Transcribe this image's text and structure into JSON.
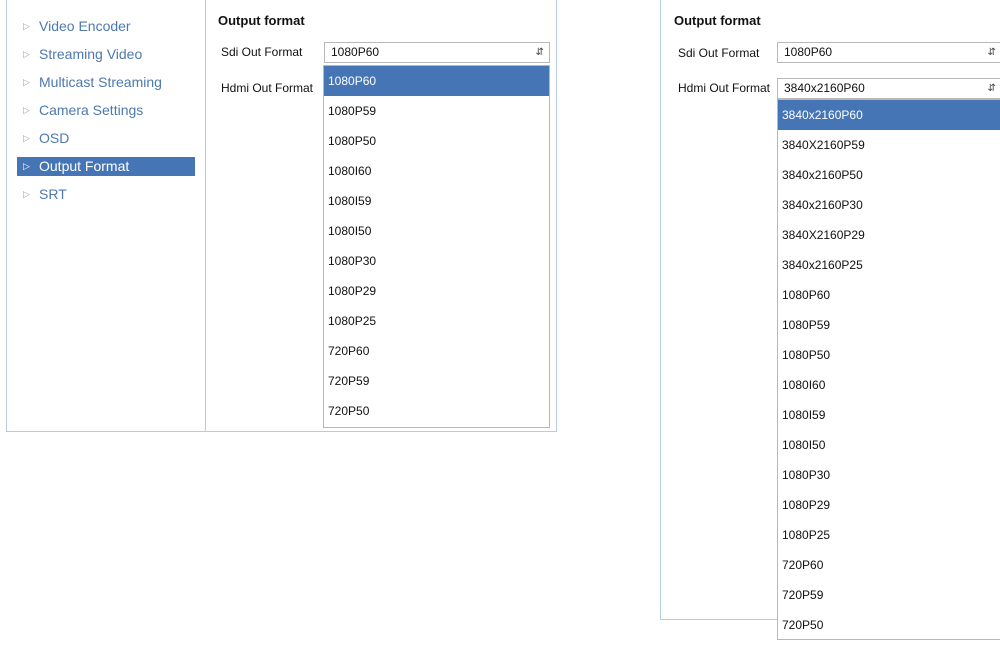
{
  "left": {
    "sidebar": {
      "items": [
        {
          "label": "Video Encoder"
        },
        {
          "label": "Streaming Video"
        },
        {
          "label": "Multicast Streaming"
        },
        {
          "label": "Camera Settings"
        },
        {
          "label": "OSD"
        },
        {
          "label": "Output Format"
        },
        {
          "label": "SRT"
        }
      ],
      "active_index": 5
    },
    "section_title": "Output format",
    "sdi_label": "Sdi Out Format",
    "sdi_value": "1080P60",
    "hdmi_label": "Hdmi Out Format",
    "dropdown_options": [
      "1080P60",
      "1080P59",
      "1080P50",
      "1080I60",
      "1080I59",
      "1080I50",
      "1080P30",
      "1080P29",
      "1080P25",
      "720P60",
      "720P59",
      "720P50"
    ],
    "dropdown_selected_index": 0
  },
  "right": {
    "section_title": "Output format",
    "sdi_label": "Sdi Out Format",
    "sdi_value": "1080P60",
    "hdmi_label": "Hdmi Out Format",
    "hdmi_value": "3840x2160P60",
    "dropdown_options": [
      "3840x2160P60",
      "3840X2160P59",
      "3840x2160P50",
      "3840x2160P30",
      "3840X2160P29",
      "3840x2160P25",
      "1080P60",
      "1080P59",
      "1080P50",
      "1080I60",
      "1080I59",
      "1080I50",
      "1080P30",
      "1080P29",
      "1080P25",
      "720P60",
      "720P59",
      "720P50"
    ],
    "dropdown_selected_index": 0
  },
  "icons": {
    "nav_arrow": "triangle-right-icon",
    "select_caret": "up-down-arrows-icon"
  }
}
